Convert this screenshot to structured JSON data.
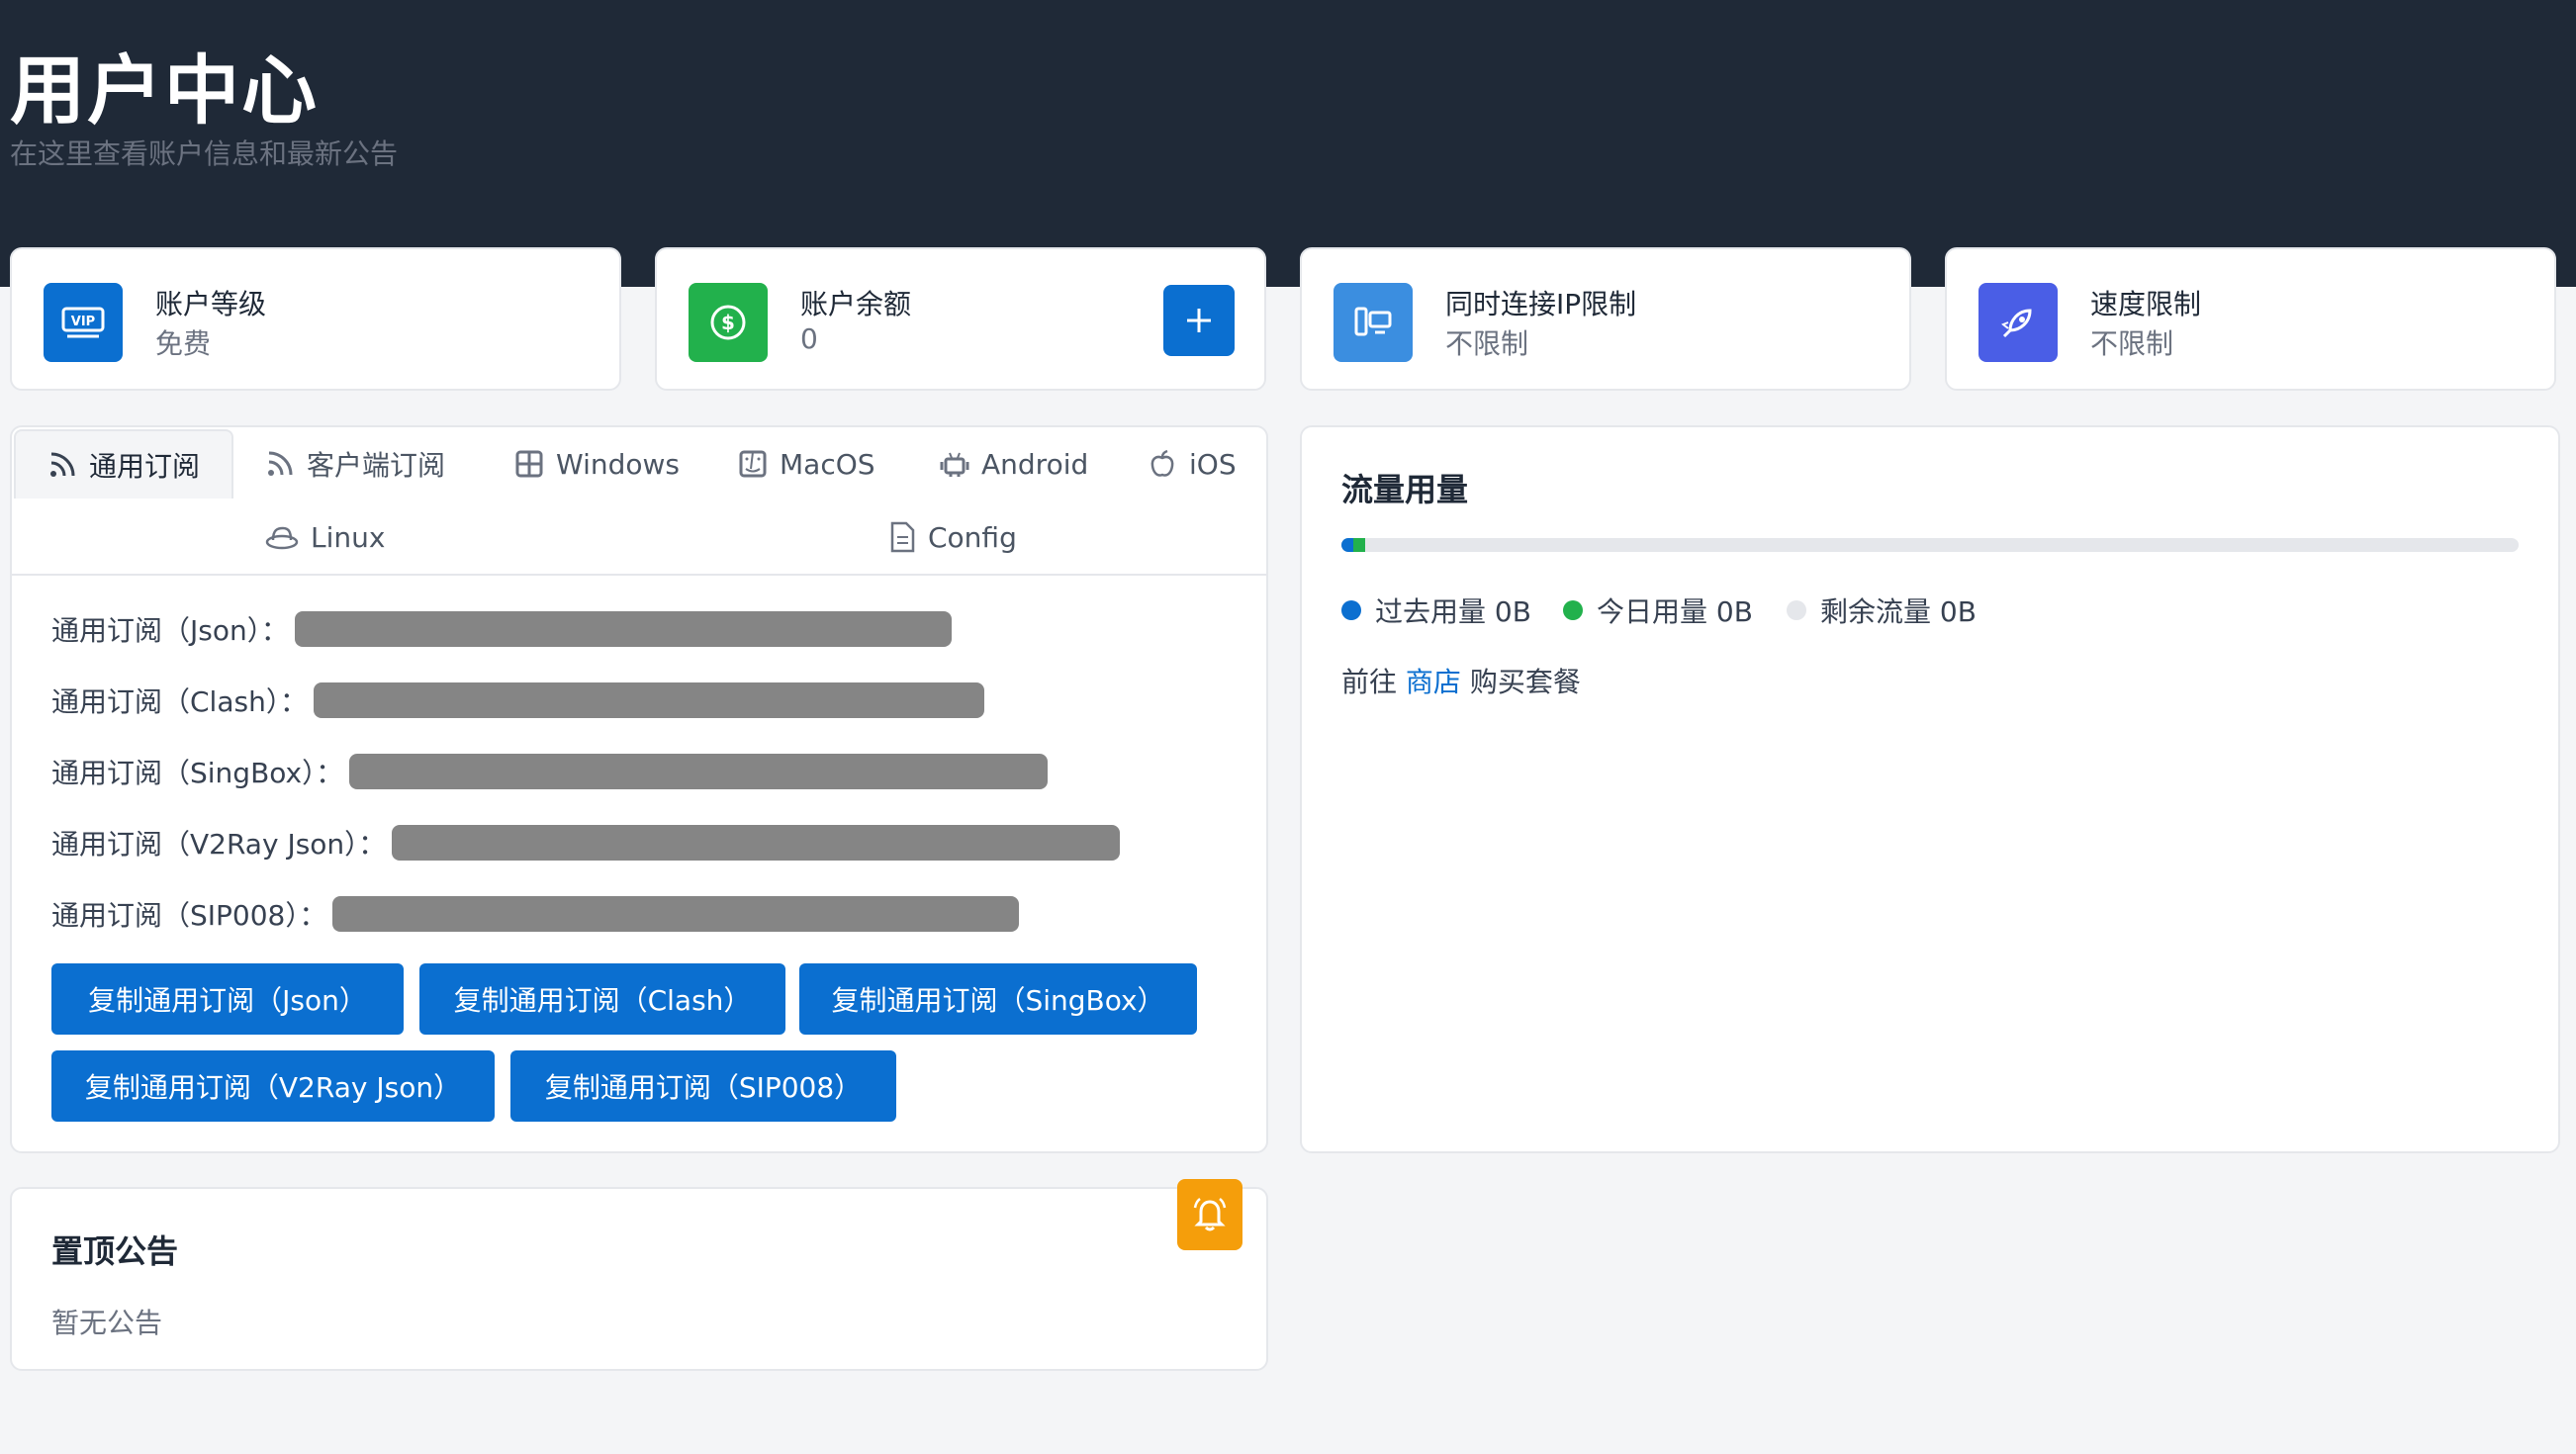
{
  "header": {
    "title": "用户中心",
    "subtitle": "在这里查看账户信息和最新公告"
  },
  "stats": [
    {
      "label": "账户等级",
      "value": "免费",
      "icon": "vip-icon",
      "color": "#0b6fd0"
    },
    {
      "label": "账户余额",
      "value": "0",
      "icon": "dollar-icon",
      "color": "#22b14c"
    },
    {
      "label": "同时连接IP限制",
      "value": "不限制",
      "icon": "devices-icon",
      "color": "#3b8ee0"
    },
    {
      "label": "速度限制",
      "value": "不限制",
      "icon": "rocket-icon",
      "color": "#4a5ee6"
    }
  ],
  "tabs": [
    {
      "label": "通用订阅",
      "icon": "rss-icon"
    },
    {
      "label": "客户端订阅",
      "icon": "rss-icon"
    },
    {
      "label": "Windows",
      "icon": "windows-icon"
    },
    {
      "label": "MacOS",
      "icon": "finder-icon"
    },
    {
      "label": "Android",
      "icon": "android-icon"
    },
    {
      "label": "iOS",
      "icon": "apple-icon"
    },
    {
      "label": "Linux",
      "icon": "redhat-icon"
    },
    {
      "label": "Config",
      "icon": "file-icon"
    }
  ],
  "subscriptions": [
    {
      "label": "通用订阅（Json）："
    },
    {
      "label": "通用订阅（Clash）："
    },
    {
      "label": "通用订阅（SingBox）："
    },
    {
      "label": "通用订阅（V2Ray Json）："
    },
    {
      "label": "通用订阅（SIP008）："
    }
  ],
  "copy_buttons": [
    "复制通用订阅（Json）",
    "复制通用订阅（Clash）",
    "复制通用订阅（SingBox）",
    "复制通用订阅（V2Ray Json）",
    "复制通用订阅（SIP008）"
  ],
  "traffic": {
    "title": "流量用量",
    "legend": [
      {
        "label": "过去用量 0B",
        "color": "#0b6fd0"
      },
      {
        "label": "今日用量 0B",
        "color": "#22b14c"
      },
      {
        "label": "剩余流量 0B",
        "color": "#e5e7eb"
      }
    ],
    "shop_prefix": "前往",
    "shop_link": "商店",
    "shop_suffix": "购买套餐"
  },
  "announcement": {
    "title": "置顶公告",
    "empty_text": "暂无公告"
  }
}
